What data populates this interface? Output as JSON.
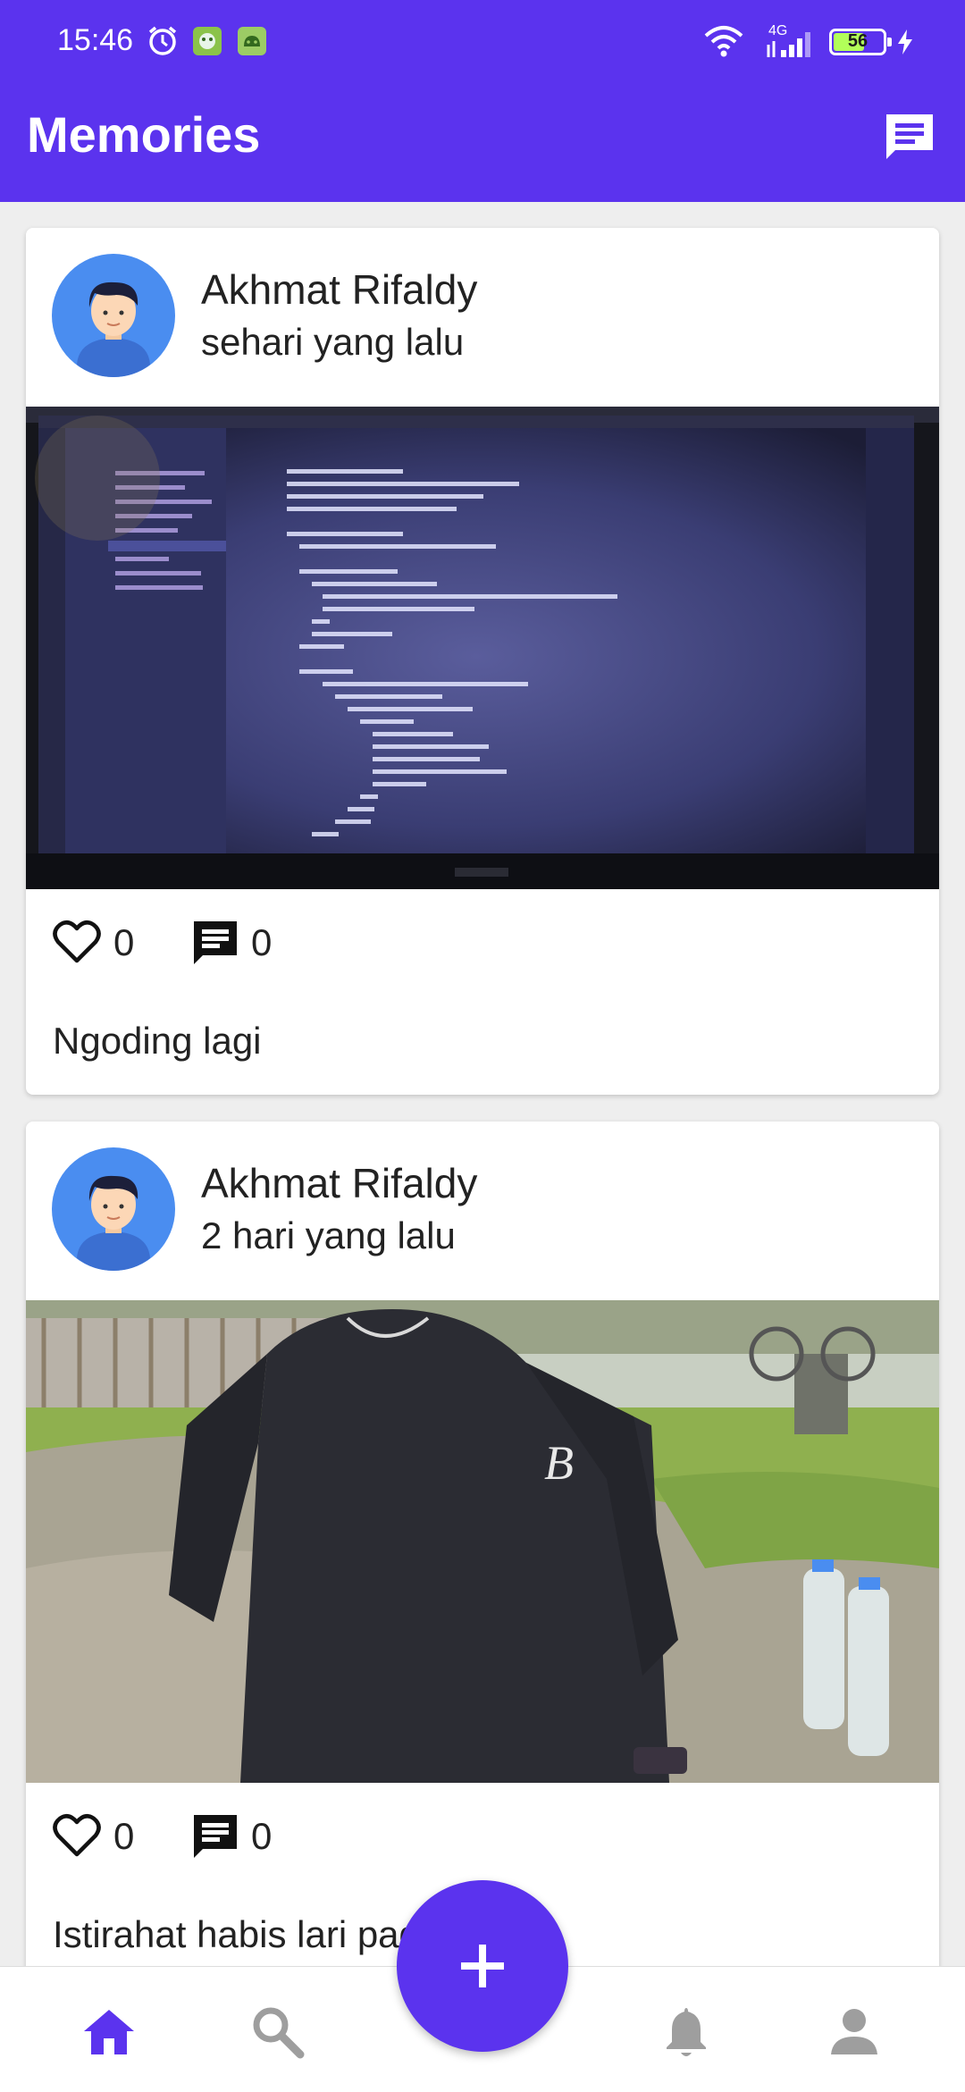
{
  "status_bar": {
    "time": "15:46",
    "network": "4G",
    "battery": "56",
    "icons": [
      "alarm-icon",
      "app-notification-icon",
      "android-icon",
      "wifi-icon",
      "signal-icon",
      "battery-icon",
      "charging-icon"
    ]
  },
  "header": {
    "title": "Memories",
    "message_icon": "chat-icon"
  },
  "posts": [
    {
      "author": "Akhmat Rifaldy",
      "time_ago": "sehari yang lalu",
      "image": "laptop-screen-code-photo",
      "likes": "0",
      "comments": "0",
      "caption": "Ngoding lagi"
    },
    {
      "author": "Akhmat Rifaldy",
      "time_ago": "2 hari yang lalu",
      "image": "person-in-park-photo",
      "likes": "0",
      "comments": "0",
      "caption": "Istirahat habis lari pagi"
    }
  ],
  "bottom_nav": {
    "items": [
      "home-icon",
      "search-icon",
      "add-icon",
      "notification-icon",
      "profile-icon"
    ],
    "active": "home-icon"
  },
  "colors": {
    "primary": "#5b33ee",
    "inactive": "#9e9e9e",
    "background": "#eeeeee"
  }
}
